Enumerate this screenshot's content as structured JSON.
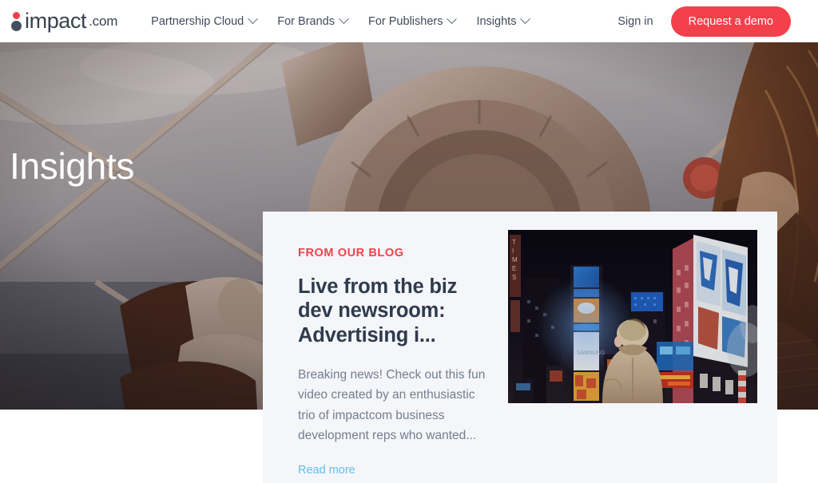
{
  "brand": {
    "logo_word": "impact",
    "logo_tld": ".com",
    "accent_red": "#F4404B",
    "navy": "#2F3B4C",
    "link_blue": "#68BCE8"
  },
  "header": {
    "nav": [
      {
        "label": "Partnership Cloud",
        "icon": "chevron-down-icon"
      },
      {
        "label": "For Brands",
        "icon": "chevron-down-icon"
      },
      {
        "label": "For Publishers",
        "icon": "chevron-down-icon"
      },
      {
        "label": "Insights",
        "icon": "chevron-down-icon"
      }
    ],
    "sign_in": "Sign in",
    "demo_button": "Request a demo"
  },
  "hero": {
    "title": "Insights",
    "image_alt": "person looking through a coin operated tower viewfinder telescope"
  },
  "card": {
    "eyebrow": "FROM OUR BLOG",
    "title": "Live from the biz dev newsroom: Advertising i...",
    "excerpt": "Breaking news! Check out this fun video created by an enthusiastic trio of impactcom business development reps who wanted...",
    "read_more": "Read more",
    "image_alt": "person standing in Times Square at night facing illuminated billboards"
  }
}
